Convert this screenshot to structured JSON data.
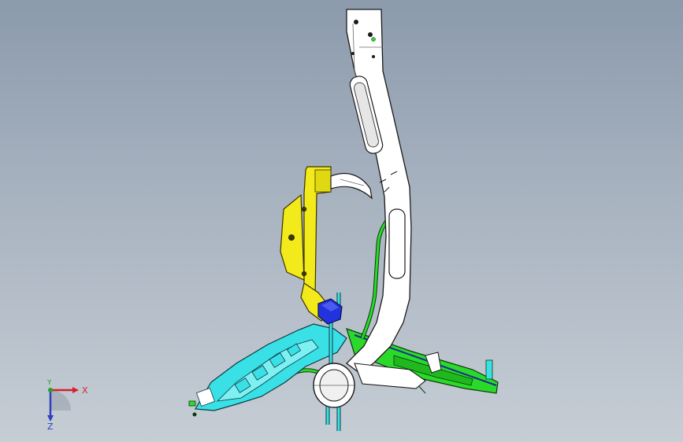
{
  "viewport": {
    "background_top": "#8b9aac",
    "background_bottom": "#c6cdd5"
  },
  "model": {
    "parts": [
      {
        "name": "main-frame-tube",
        "color": "#ffffff"
      },
      {
        "name": "yellow-bracket",
        "color": "#f2ea1a"
      },
      {
        "name": "cyan-bracket",
        "color": "#39e0e6"
      },
      {
        "name": "green-frame-rail",
        "color": "#2bd92b"
      },
      {
        "name": "blue-mount-block",
        "color": "#2233dd"
      },
      {
        "name": "head-tube",
        "color": "#ffffff"
      }
    ]
  },
  "triad": {
    "x_label": "X",
    "y_label": "Y",
    "z_label": "Z",
    "x_color": "#d8202a",
    "y_color": "#2a9d2a",
    "z_color": "#2b3fbf"
  }
}
